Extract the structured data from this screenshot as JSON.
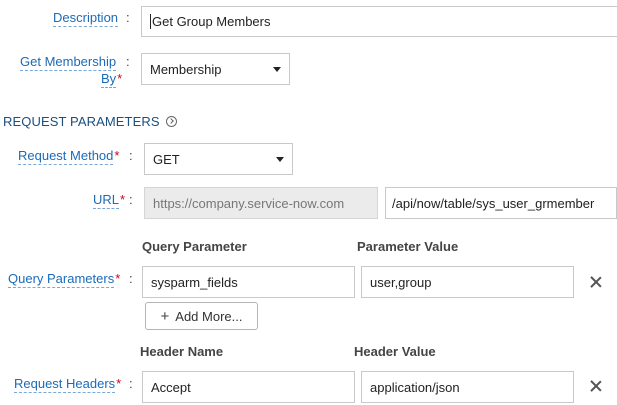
{
  "description": {
    "label": "Description",
    "value": "Get Group Members"
  },
  "membership": {
    "label_line1": "Get Membership",
    "label_line2": "By",
    "selected": "Membership"
  },
  "section": {
    "title": "REQUEST PARAMETERS"
  },
  "request_method": {
    "label": "Request Method",
    "selected": "GET"
  },
  "url": {
    "label": "URL",
    "base": "https://company.service-now.com",
    "path": "/api/now/table/sys_user_grmember"
  },
  "query": {
    "label": "Query Parameters",
    "col_param": "Query Parameter",
    "col_value": "Parameter Value",
    "rows": [
      {
        "param": "sysparm_fields",
        "value": "user,group"
      }
    ],
    "add_more": "Add More..."
  },
  "headers": {
    "label": "Request Headers",
    "col_name": "Header Name",
    "col_value": "Header Value",
    "rows": [
      {
        "name": "Accept",
        "value": "application/json"
      }
    ]
  },
  "common": {
    "colon": ":",
    "required_mark": "*"
  }
}
